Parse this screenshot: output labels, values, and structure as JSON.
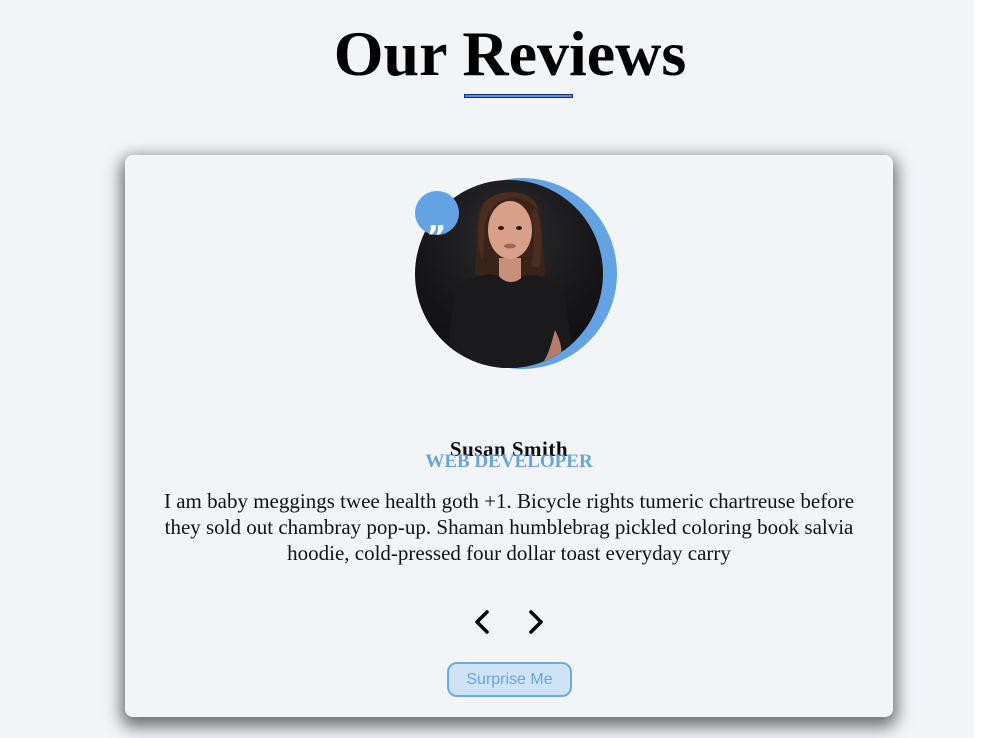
{
  "page": {
    "title": "Our Reviews",
    "accent_color": "#63a3e4"
  },
  "review": {
    "name": "Susan Smith",
    "job": "WEB DEVELOPER",
    "text": "I am baby meggings twee health goth +1. Bicycle rights tumeric chartreuse before they sold out chambray pop-up. Shaman humblebrag pickled coloring book salvia hoodie, cold-pressed four dollar toast everyday carry",
    "quote_icon": "quote-icon",
    "quote_glyph": "„"
  },
  "controls": {
    "prev_icon": "chevron-left-icon",
    "next_icon": "chevron-right-icon",
    "surprise_label": "Surprise Me"
  }
}
